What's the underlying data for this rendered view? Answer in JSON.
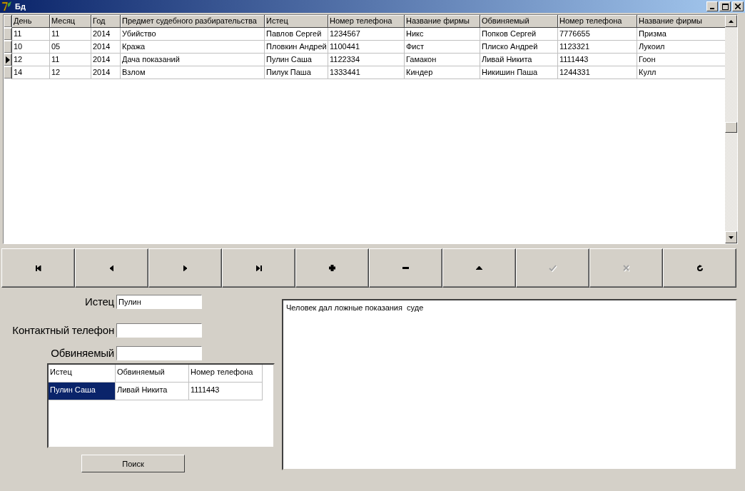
{
  "window": {
    "title": "Бд"
  },
  "main_table": {
    "columns": [
      "День",
      "Месяц",
      "Год",
      "Предмет судебного разбирательства",
      "Истец",
      "Номер телефона",
      "Название фирмы",
      "Обвиняемый",
      "Номер телефона",
      "Название фирмы"
    ],
    "rows": [
      {
        "selected": false,
        "cells": [
          "11",
          "11",
          "2014",
          "Убийство",
          "Павлов Сергей",
          "1234567",
          "Никс",
          "Попков Сергей",
          "7776655",
          "Призма"
        ]
      },
      {
        "selected": false,
        "cells": [
          "10",
          "05",
          "2014",
          "Кража",
          "Пловкин Андрей",
          "1100441",
          "Фист",
          "Плиско Андрей",
          "1123321",
          "Лукоил"
        ]
      },
      {
        "selected": true,
        "cells": [
          "12",
          "11",
          "2014",
          "Дача показаний",
          "Пулин Саша",
          "1122334",
          " Гамакон",
          "Ливай Никита",
          "1111443",
          "Гоон"
        ]
      },
      {
        "selected": false,
        "cells": [
          "14",
          "12",
          "2014",
          "Взлом",
          "Пилук Паша",
          "1333441",
          "Киндер",
          "Никишин Паша",
          "1244331",
          "Кулл"
        ]
      }
    ]
  },
  "navigator": [
    {
      "kind": "first",
      "disabled": false
    },
    {
      "kind": "prior",
      "disabled": false
    },
    {
      "kind": "next",
      "disabled": false
    },
    {
      "kind": "last",
      "disabled": false
    },
    {
      "kind": "insert",
      "disabled": false
    },
    {
      "kind": "delete",
      "disabled": false
    },
    {
      "kind": "edit",
      "disabled": false
    },
    {
      "kind": "post",
      "disabled": true
    },
    {
      "kind": "cancel",
      "disabled": true
    },
    {
      "kind": "refresh",
      "disabled": false
    }
  ],
  "form": [
    {
      "label": "Истец",
      "value": "Пулин"
    },
    {
      "label": "Контактный телефон"
    },
    {
      "label": "Обвиняемый"
    }
  ],
  "search_results": {
    "columns": [
      "Истец",
      "Обвиняемый",
      "Номер телефона"
    ],
    "rows": [
      {
        "selected": true,
        "cells": [
          "Пулин Саша",
          "Ливай Никита",
          "1111443"
        ]
      }
    ]
  },
  "search_button": "Поиск",
  "memo": "Человек дал ложные показания  суде"
}
